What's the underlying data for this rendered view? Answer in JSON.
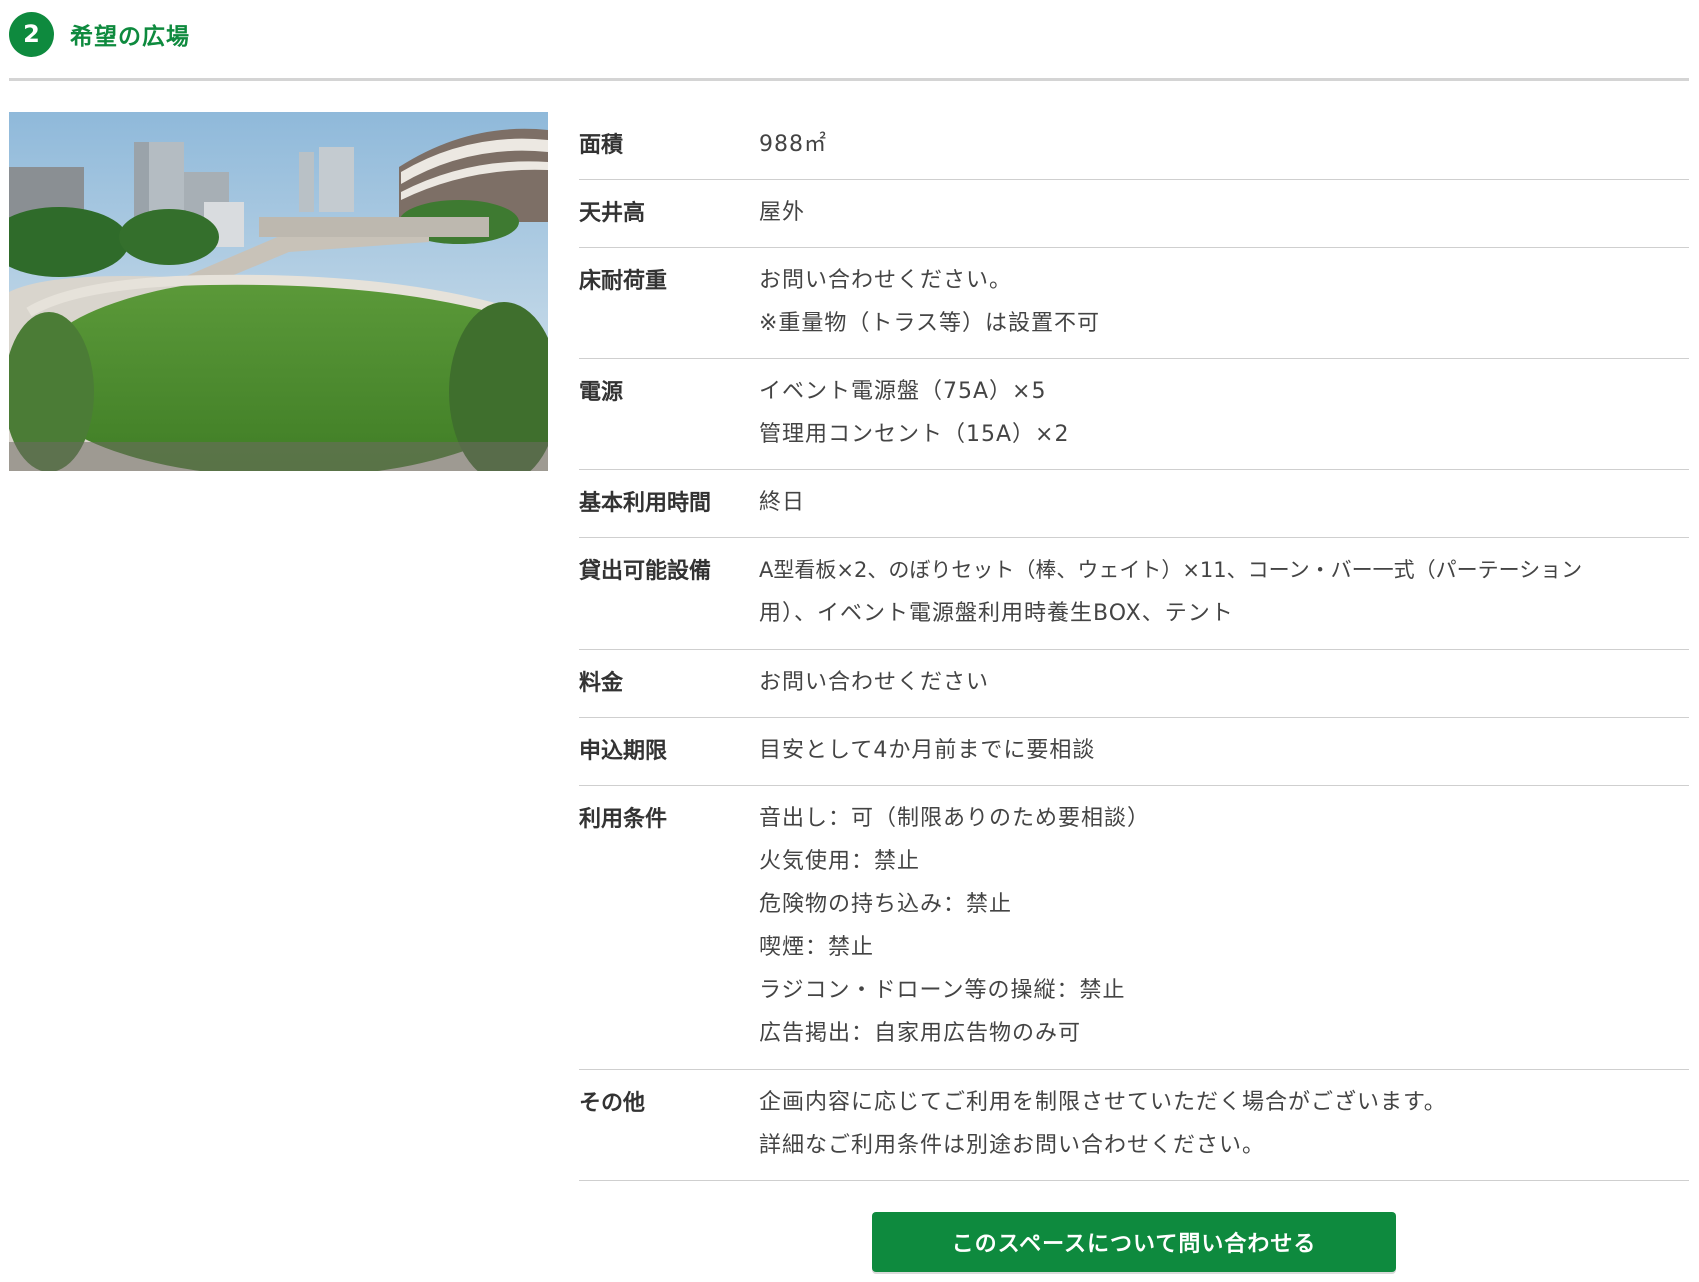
{
  "header": {
    "number": "2",
    "title": "希望の広場"
  },
  "specs": [
    {
      "label": "面積",
      "lines": [
        "988㎡"
      ]
    },
    {
      "label": "天井高",
      "lines": [
        "屋外"
      ]
    },
    {
      "label": "床耐荷重",
      "lines": [
        "お問い合わせください。",
        "※重量物（トラス等）は設置不可"
      ]
    },
    {
      "label": "電源",
      "lines": [
        "イベント電源盤（75A）×5",
        "管理用コンセント（15A）×2"
      ]
    },
    {
      "label": "基本利用時間",
      "lines": [
        "終日"
      ]
    },
    {
      "label": "貸出可能設備",
      "lines": [
        "A型看板×2、のぼりセット（棒、ウェイト）×11、コーン・バー一式（パーテーション",
        "用）、イベント電源盤利用時養生BOX、テント"
      ]
    },
    {
      "label": "料金",
      "lines": [
        "お問い合わせください"
      ]
    },
    {
      "label": "申込期限",
      "lines": [
        "目安として4か月前までに要相談"
      ]
    },
    {
      "label": "利用条件",
      "lines": [
        "音出し：可（制限ありのため要相談）",
        "火気使用：禁止",
        "危険物の持ち込み：禁止",
        "喫煙：禁止",
        "ラジコン・ドローン等の操縦：禁止",
        "広告掲出：自家用広告物のみ可"
      ]
    },
    {
      "label": "その他",
      "lines": [
        "企画内容に応じてご利用を制限させていただく場合がございます。",
        "詳細なご利用条件は別途お問い合わせください。"
      ]
    }
  ],
  "cta": {
    "label": "このスペースについて問い合わせる"
  },
  "colors": {
    "accent": "#0e8a3e",
    "divider": "#cfcfcf"
  }
}
